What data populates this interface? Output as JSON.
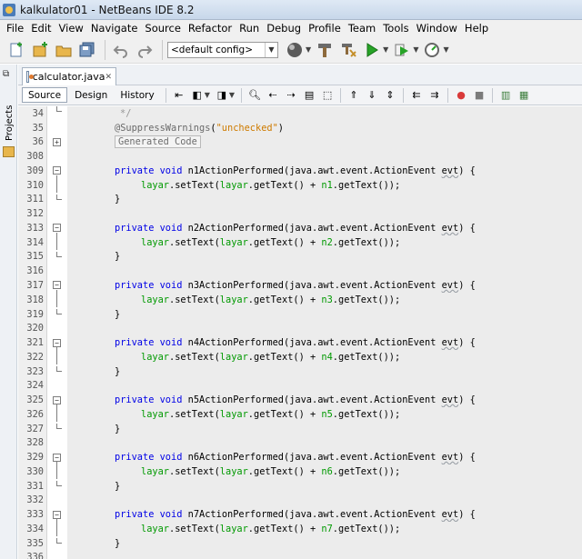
{
  "window": {
    "title": "kalkulator01 - NetBeans IDE 8.2"
  },
  "menu": [
    "File",
    "Edit",
    "View",
    "Navigate",
    "Source",
    "Refactor",
    "Run",
    "Debug",
    "Profile",
    "Team",
    "Tools",
    "Window",
    "Help"
  ],
  "toolbar": {
    "config_value": "<default config>"
  },
  "sidebar": {
    "projects_label": "Projects"
  },
  "editor": {
    "tab_name": "calculator.java",
    "views": [
      "Source",
      "Design",
      "History"
    ]
  },
  "code": {
    "lines": [
      {
        "no": "34",
        "text": "*/"
      },
      {
        "no": "35",
        "text": "@SuppressWarnings(\"unchecked\")"
      },
      {
        "no": "36",
        "text": "Generated Code"
      },
      {
        "no": "308",
        "text": ""
      },
      {
        "no": "309",
        "text": "private void n1ActionPerformed(java.awt.event.ActionEvent evt) {"
      },
      {
        "no": "310",
        "text": "layar.setText(layar.getText() + n1.getText());"
      },
      {
        "no": "311",
        "text": "}"
      },
      {
        "no": "312",
        "text": ""
      },
      {
        "no": "313",
        "text": "private void n2ActionPerformed(java.awt.event.ActionEvent evt) {"
      },
      {
        "no": "314",
        "text": "layar.setText(layar.getText() + n2.getText());"
      },
      {
        "no": "315",
        "text": "}"
      },
      {
        "no": "316",
        "text": ""
      },
      {
        "no": "317",
        "text": "private void n3ActionPerformed(java.awt.event.ActionEvent evt) {"
      },
      {
        "no": "318",
        "text": "layar.setText(layar.getText() + n3.getText());"
      },
      {
        "no": "319",
        "text": "}"
      },
      {
        "no": "320",
        "text": ""
      },
      {
        "no": "321",
        "text": "private void n4ActionPerformed(java.awt.event.ActionEvent evt) {"
      },
      {
        "no": "322",
        "text": "layar.setText(layar.getText() + n4.getText());"
      },
      {
        "no": "323",
        "text": "}"
      },
      {
        "no": "324",
        "text": ""
      },
      {
        "no": "325",
        "text": "private void n5ActionPerformed(java.awt.event.ActionEvent evt) {"
      },
      {
        "no": "326",
        "text": "layar.setText(layar.getText() + n5.getText());"
      },
      {
        "no": "327",
        "text": "}"
      },
      {
        "no": "328",
        "text": ""
      },
      {
        "no": "329",
        "text": "private void n6ActionPerformed(java.awt.event.ActionEvent evt) {"
      },
      {
        "no": "330",
        "text": "layar.setText(layar.getText() + n6.getText());"
      },
      {
        "no": "331",
        "text": "}"
      },
      {
        "no": "332",
        "text": ""
      },
      {
        "no": "333",
        "text": "private void n7ActionPerformed(java.awt.event.ActionEvent evt) {"
      },
      {
        "no": "334",
        "text": "layar.setText(layar.getText() + n7.getText());"
      },
      {
        "no": "335",
        "text": "}"
      },
      {
        "no": "336",
        "text": ""
      }
    ]
  },
  "colors": {
    "keyword": "#0000e6",
    "string": "#ce7b00",
    "field": "#009900",
    "annotation": "#6a6a6a"
  }
}
